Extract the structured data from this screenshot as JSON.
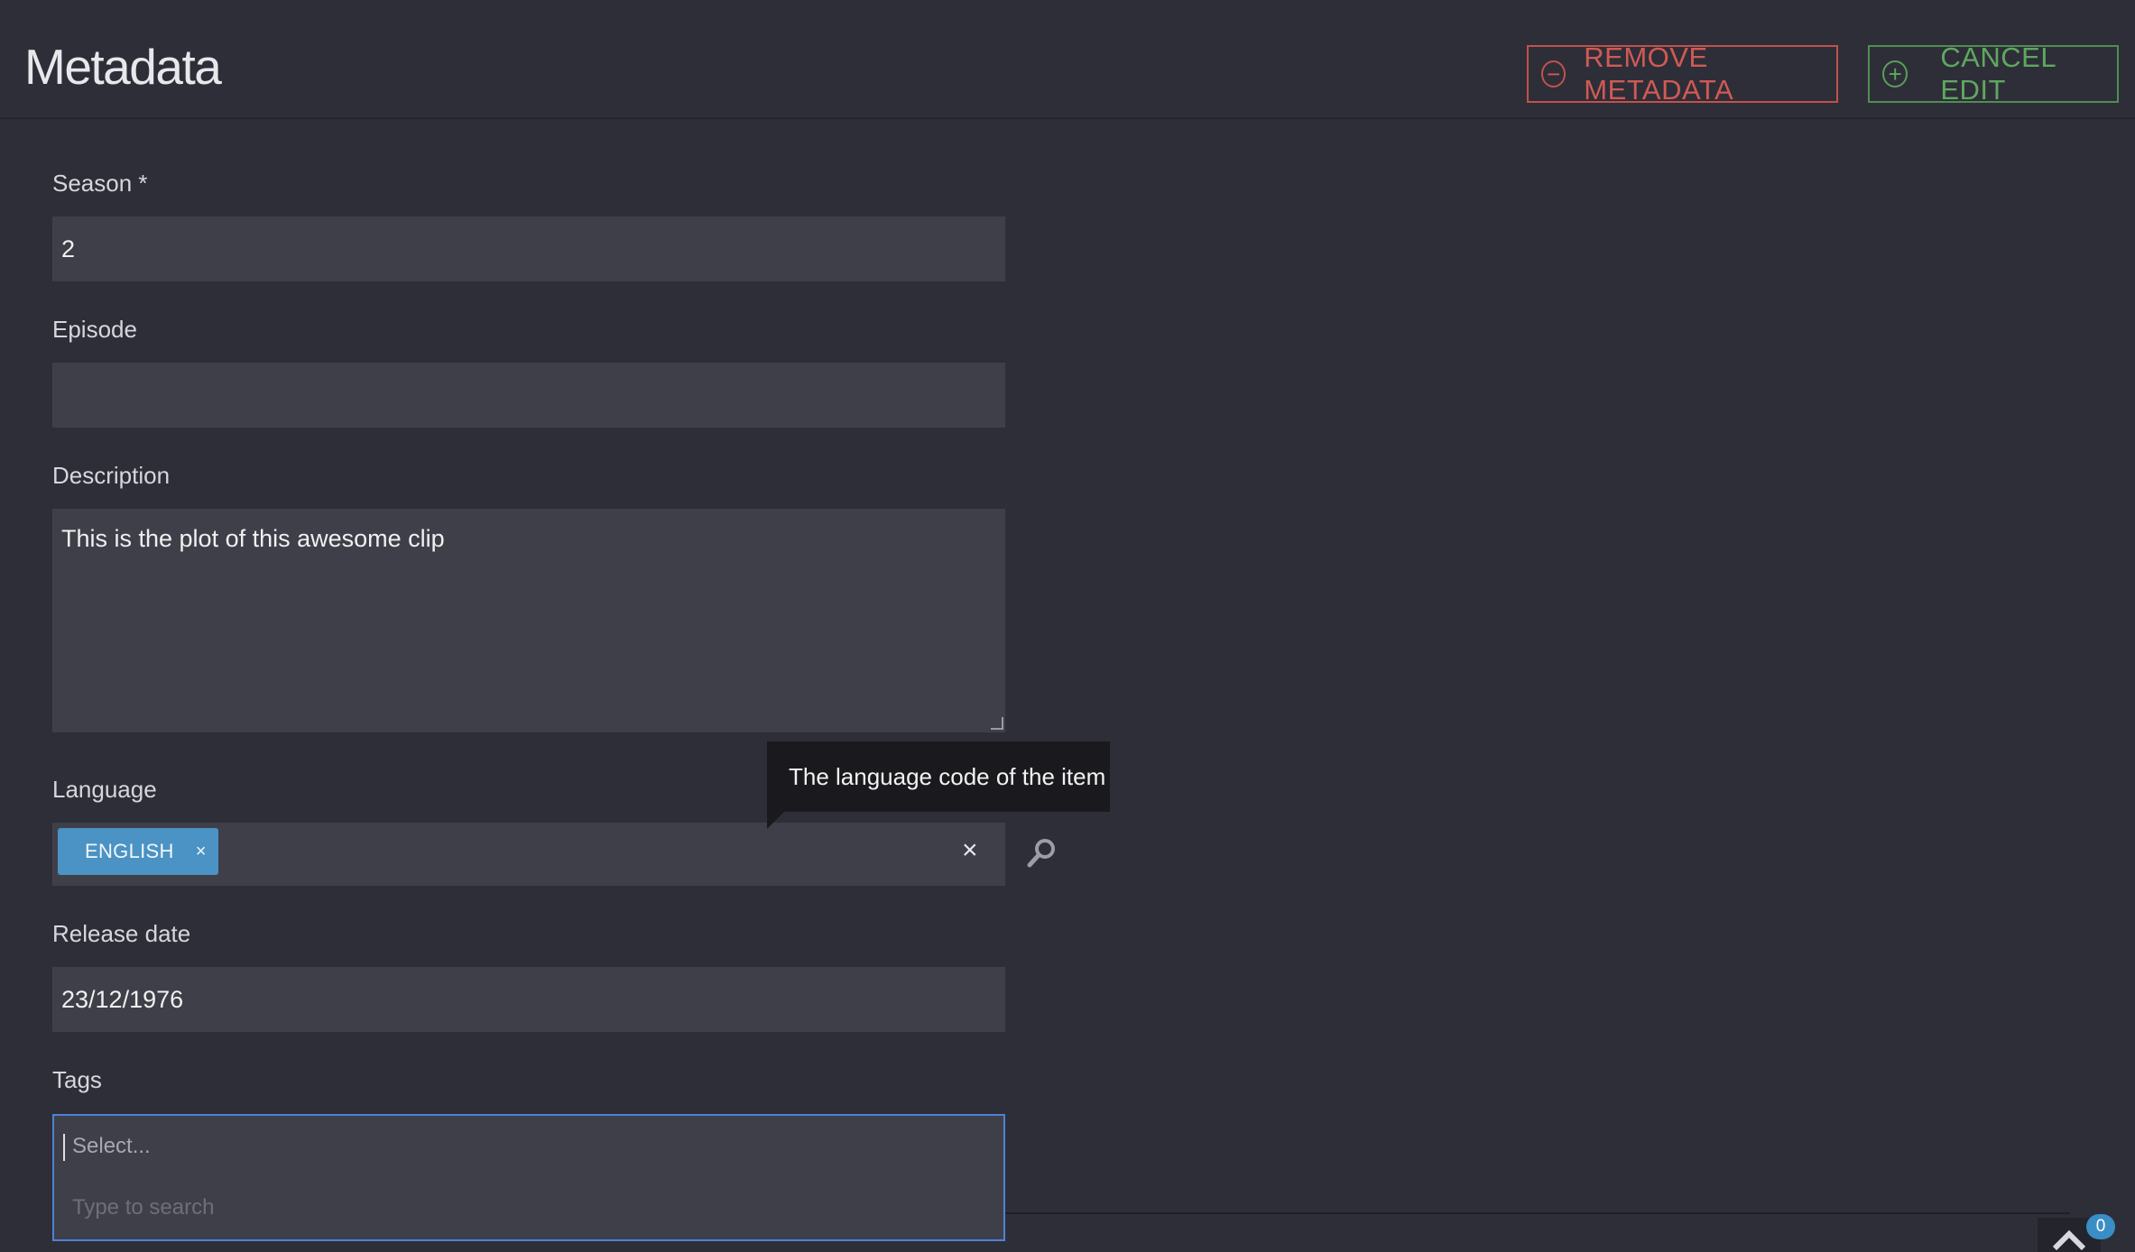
{
  "header": {
    "title": "Metadata",
    "remove_label": "REMOVE METADATA",
    "cancel_label": "CANCEL EDIT"
  },
  "form": {
    "season": {
      "label": "Season *",
      "value": "2"
    },
    "episode": {
      "label": "Episode",
      "value": ""
    },
    "description": {
      "label": "Description",
      "value": "This is the plot of this awesome clip"
    },
    "language": {
      "label": "Language",
      "chip": "ENGLISH",
      "chip_remove": "×",
      "clear": "×",
      "tooltip": "The language code of the item"
    },
    "release_date": {
      "label": "Release date",
      "value": "23/12/1976"
    },
    "tags": {
      "label": "Tags",
      "placeholder": "Select...",
      "search_hint": "Type to search"
    }
  },
  "footer": {
    "badge_count": "0"
  },
  "colors": {
    "background": "#2e2e38",
    "input_bg": "#3f3f4a",
    "remove": "#d05a55",
    "cancel": "#5fa860",
    "chip": "#4a93c4",
    "focus": "#4d82d6"
  },
  "icons": {
    "remove": "minus-circle-icon",
    "cancel": "plus-circle-icon",
    "search": "magnifier-icon",
    "scroll_top": "chevron-up-icon"
  }
}
